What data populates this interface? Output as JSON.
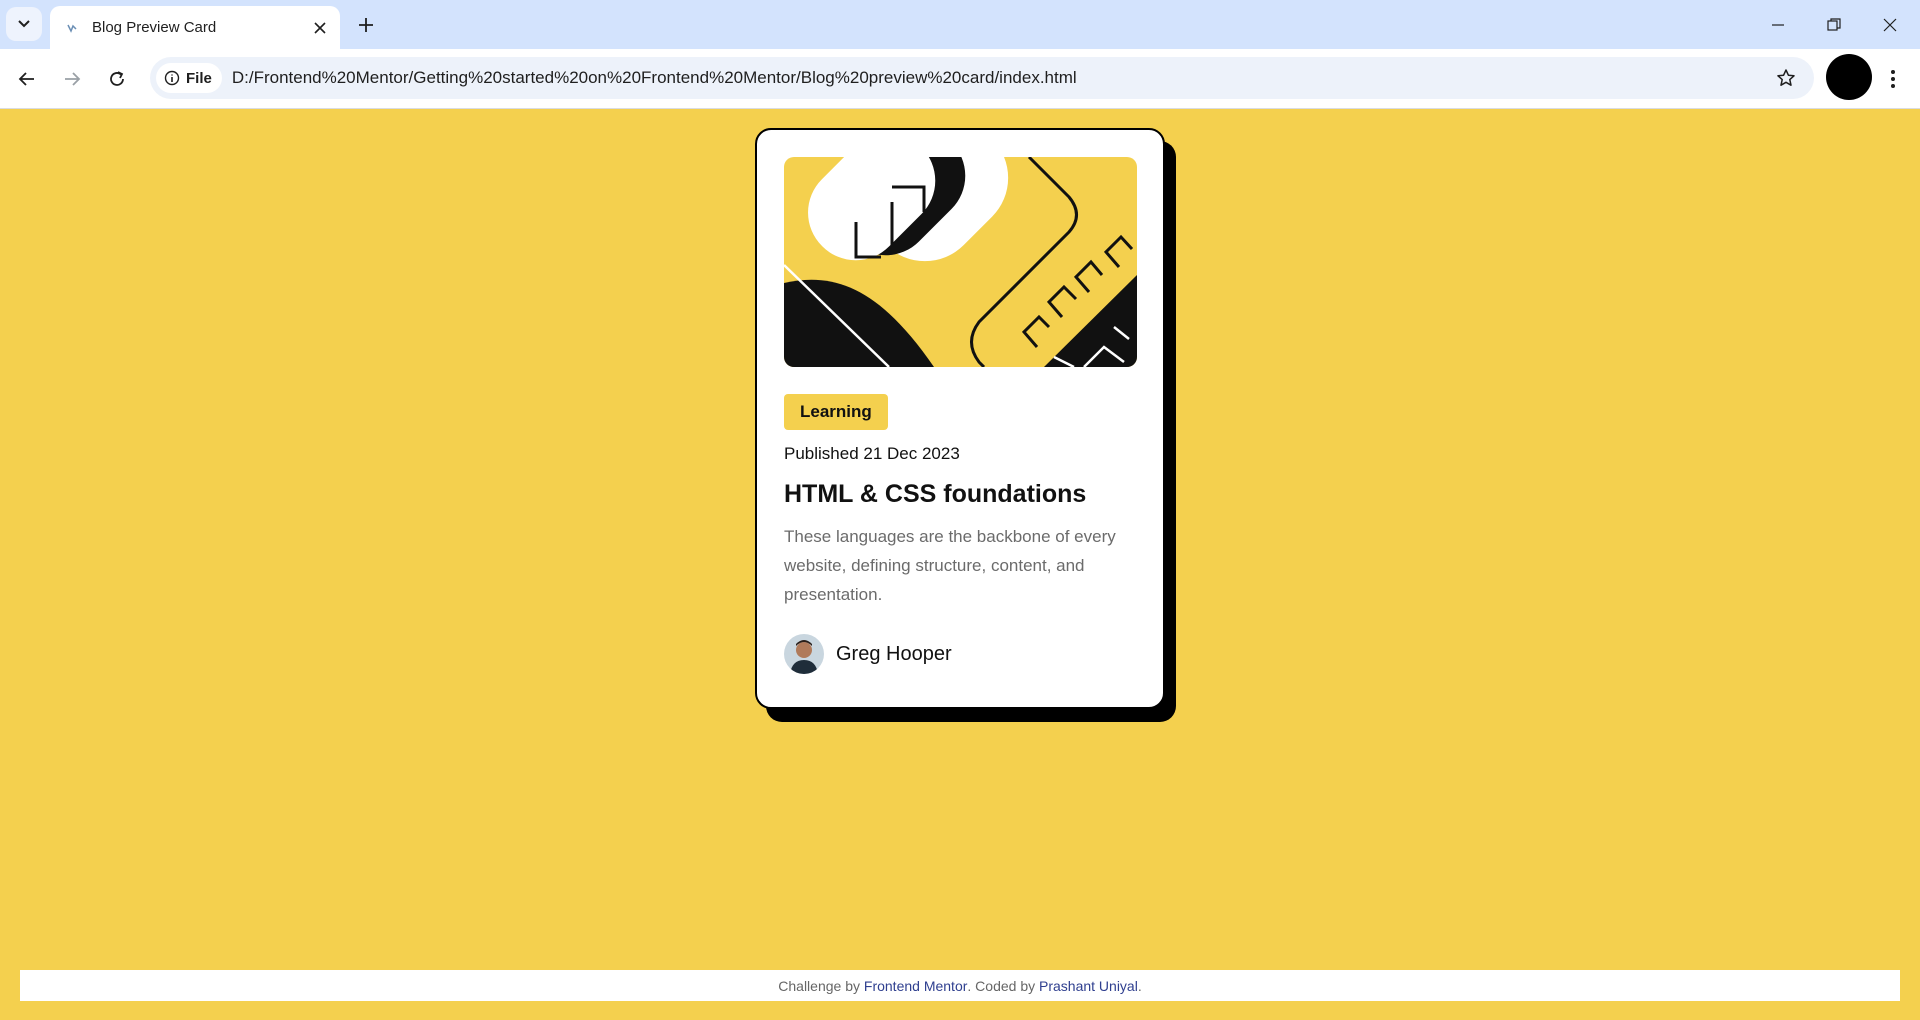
{
  "browser": {
    "tab_title": "Blog Preview Card",
    "site_chip_label": "File",
    "url": "D:/Frontend%20Mentor/Getting%20started%20on%20Frontend%20Mentor/Blog%20preview%20card/index.html"
  },
  "card": {
    "tag": "Learning",
    "published": "Published 21 Dec 2023",
    "title": "HTML & CSS foundations",
    "description": "These languages are the backbone of every website, defining structure, content, and presentation.",
    "author": "Greg Hooper"
  },
  "footer": {
    "challenge_prefix": "Challenge by",
    "challenge_link": "Frontend Mentor",
    "coded_prefix": ". Coded by",
    "coded_link": "Prashant Uniyal",
    "suffix": "."
  },
  "colors": {
    "background": "#f4d04e",
    "card": "#ffffff",
    "text": "#111111",
    "muted_text": "#6b6b6b",
    "tabbar": "#d3e3fd"
  },
  "icons": [
    "chevron-down-icon",
    "favicon-icon",
    "close-icon",
    "plus-icon",
    "minimize-icon",
    "restore-icon",
    "back-icon",
    "forward-icon",
    "reload-icon",
    "info-icon",
    "star-icon",
    "more-vert-icon"
  ]
}
